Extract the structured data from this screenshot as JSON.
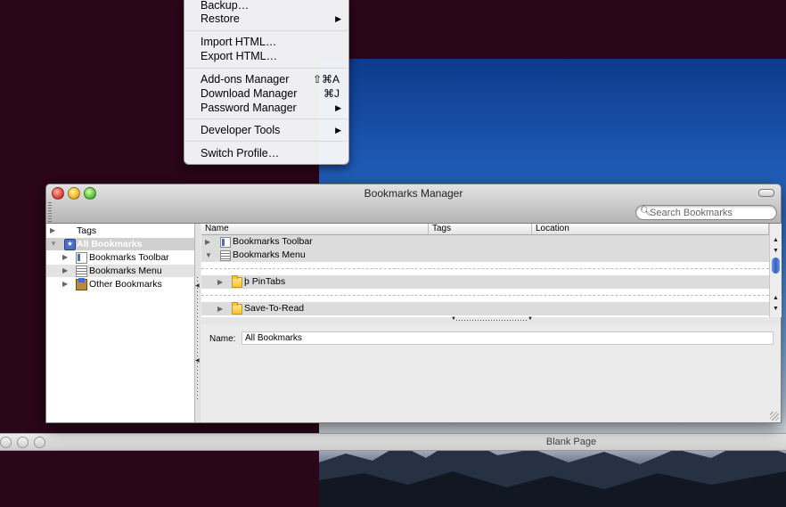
{
  "menu": {
    "items": [
      {
        "label": "Backup…",
        "shortcut": "",
        "submenu": false
      },
      {
        "label": "Restore",
        "shortcut": "",
        "submenu": true
      },
      {
        "label": "Import HTML…",
        "shortcut": "",
        "submenu": false
      },
      {
        "label": "Export HTML…",
        "shortcut": "",
        "submenu": false
      },
      {
        "label": "Add-ons Manager",
        "shortcut": "⇧⌘A",
        "submenu": false
      },
      {
        "label": "Download Manager",
        "shortcut": "⌘J",
        "submenu": false
      },
      {
        "label": "Password Manager",
        "shortcut": "",
        "submenu": true
      },
      {
        "label": "Developer Tools",
        "shortcut": "",
        "submenu": true
      },
      {
        "label": "Switch Profile…",
        "shortcut": "",
        "submenu": false
      }
    ]
  },
  "bookmarks_window": {
    "title": "Bookmarks Manager",
    "search_placeholder": "Search Bookmarks",
    "sidebar": {
      "items": [
        {
          "label": "Tags",
          "icon": "tag-icon"
        },
        {
          "label": "All Bookmarks",
          "icon": "star-icon",
          "selected": true
        },
        {
          "label": "Bookmarks Toolbar",
          "icon": "toolbar-icon"
        },
        {
          "label": "Bookmarks Menu",
          "icon": "menu-icon"
        },
        {
          "label": "Other Bookmarks",
          "icon": "folder-icon"
        }
      ]
    },
    "table": {
      "columns": [
        "Name",
        "Tags",
        "Location"
      ],
      "rows": [
        {
          "name": "Bookmarks Toolbar",
          "icon": "toolbar-icon",
          "expanded": false
        },
        {
          "name": "Bookmarks Menu",
          "icon": "menu-icon",
          "expanded": true
        },
        {
          "name": "ϸ PinTabs",
          "icon": "folder-icon",
          "expanded": false
        },
        {
          "name": "Save-To-Read",
          "icon": "folder-icon",
          "expanded": false
        }
      ]
    },
    "details": {
      "name_label": "Name:",
      "name_value": "All Bookmarks"
    }
  },
  "background_window": {
    "title": "Blank Page"
  },
  "colors": {
    "desktop": "#2a0618",
    "selection": "#d0d0d0",
    "scroll_thumb": "#2f63c8"
  }
}
